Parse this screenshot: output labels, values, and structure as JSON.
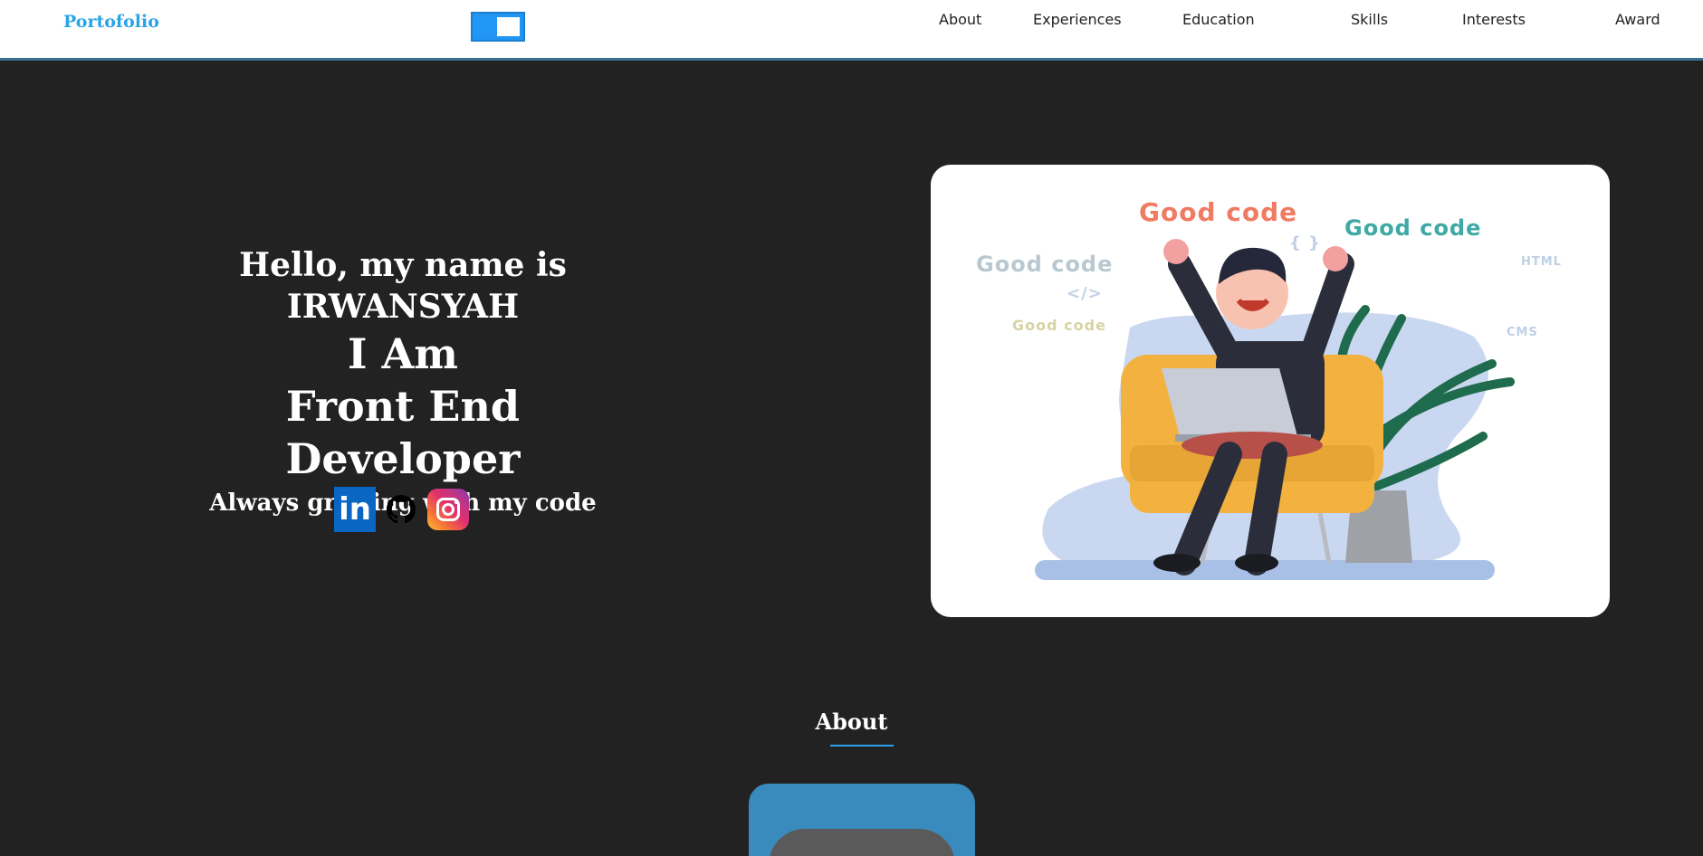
{
  "nav": {
    "brand": "Portofolio",
    "items": [
      {
        "label": "About"
      },
      {
        "label": "Experiences"
      },
      {
        "label": "Education"
      },
      {
        "label": "Skills"
      },
      {
        "label": "Interests"
      },
      {
        "label": "Award"
      }
    ]
  },
  "hero": {
    "greeting": "Hello, my name is IRWANSYAH",
    "role_line1": "I Am",
    "role_line2": "Front End",
    "role_line3": "Developer",
    "tagline": "Always growing with my code",
    "linkedin_glyph": "in",
    "illustration": {
      "words": [
        "Good code",
        "Good code",
        "Good code",
        "Good code"
      ],
      "tags": [
        "{ }",
        "</>",
        "HTML",
        "CMS"
      ]
    }
  },
  "about": {
    "heading": "About"
  },
  "colors": {
    "brand": "#2aa4e8",
    "background": "#222222",
    "toggle": "#2196f3",
    "about_card": "#3a8bbd"
  }
}
